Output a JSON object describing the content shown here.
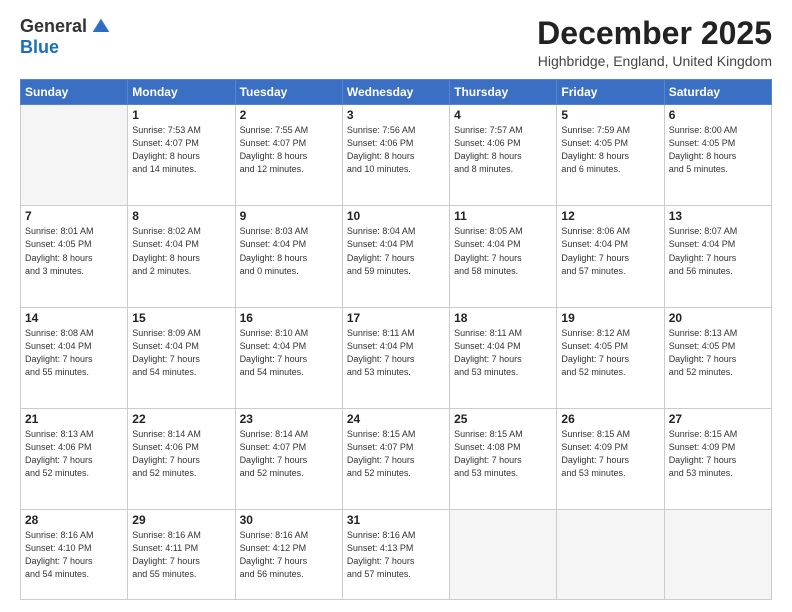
{
  "header": {
    "logo_general": "General",
    "logo_blue": "Blue",
    "title": "December 2025",
    "location": "Highbridge, England, United Kingdom"
  },
  "weekdays": [
    "Sunday",
    "Monday",
    "Tuesday",
    "Wednesday",
    "Thursday",
    "Friday",
    "Saturday"
  ],
  "weeks": [
    [
      {
        "day": "",
        "info": ""
      },
      {
        "day": "1",
        "info": "Sunrise: 7:53 AM\nSunset: 4:07 PM\nDaylight: 8 hours\nand 14 minutes."
      },
      {
        "day": "2",
        "info": "Sunrise: 7:55 AM\nSunset: 4:07 PM\nDaylight: 8 hours\nand 12 minutes."
      },
      {
        "day": "3",
        "info": "Sunrise: 7:56 AM\nSunset: 4:06 PM\nDaylight: 8 hours\nand 10 minutes."
      },
      {
        "day": "4",
        "info": "Sunrise: 7:57 AM\nSunset: 4:06 PM\nDaylight: 8 hours\nand 8 minutes."
      },
      {
        "day": "5",
        "info": "Sunrise: 7:59 AM\nSunset: 4:05 PM\nDaylight: 8 hours\nand 6 minutes."
      },
      {
        "day": "6",
        "info": "Sunrise: 8:00 AM\nSunset: 4:05 PM\nDaylight: 8 hours\nand 5 minutes."
      }
    ],
    [
      {
        "day": "7",
        "info": "Sunrise: 8:01 AM\nSunset: 4:05 PM\nDaylight: 8 hours\nand 3 minutes."
      },
      {
        "day": "8",
        "info": "Sunrise: 8:02 AM\nSunset: 4:04 PM\nDaylight: 8 hours\nand 2 minutes."
      },
      {
        "day": "9",
        "info": "Sunrise: 8:03 AM\nSunset: 4:04 PM\nDaylight: 8 hours\nand 0 minutes."
      },
      {
        "day": "10",
        "info": "Sunrise: 8:04 AM\nSunset: 4:04 PM\nDaylight: 7 hours\nand 59 minutes."
      },
      {
        "day": "11",
        "info": "Sunrise: 8:05 AM\nSunset: 4:04 PM\nDaylight: 7 hours\nand 58 minutes."
      },
      {
        "day": "12",
        "info": "Sunrise: 8:06 AM\nSunset: 4:04 PM\nDaylight: 7 hours\nand 57 minutes."
      },
      {
        "day": "13",
        "info": "Sunrise: 8:07 AM\nSunset: 4:04 PM\nDaylight: 7 hours\nand 56 minutes."
      }
    ],
    [
      {
        "day": "14",
        "info": "Sunrise: 8:08 AM\nSunset: 4:04 PM\nDaylight: 7 hours\nand 55 minutes."
      },
      {
        "day": "15",
        "info": "Sunrise: 8:09 AM\nSunset: 4:04 PM\nDaylight: 7 hours\nand 54 minutes."
      },
      {
        "day": "16",
        "info": "Sunrise: 8:10 AM\nSunset: 4:04 PM\nDaylight: 7 hours\nand 54 minutes."
      },
      {
        "day": "17",
        "info": "Sunrise: 8:11 AM\nSunset: 4:04 PM\nDaylight: 7 hours\nand 53 minutes."
      },
      {
        "day": "18",
        "info": "Sunrise: 8:11 AM\nSunset: 4:04 PM\nDaylight: 7 hours\nand 53 minutes."
      },
      {
        "day": "19",
        "info": "Sunrise: 8:12 AM\nSunset: 4:05 PM\nDaylight: 7 hours\nand 52 minutes."
      },
      {
        "day": "20",
        "info": "Sunrise: 8:13 AM\nSunset: 4:05 PM\nDaylight: 7 hours\nand 52 minutes."
      }
    ],
    [
      {
        "day": "21",
        "info": "Sunrise: 8:13 AM\nSunset: 4:06 PM\nDaylight: 7 hours\nand 52 minutes."
      },
      {
        "day": "22",
        "info": "Sunrise: 8:14 AM\nSunset: 4:06 PM\nDaylight: 7 hours\nand 52 minutes."
      },
      {
        "day": "23",
        "info": "Sunrise: 8:14 AM\nSunset: 4:07 PM\nDaylight: 7 hours\nand 52 minutes."
      },
      {
        "day": "24",
        "info": "Sunrise: 8:15 AM\nSunset: 4:07 PM\nDaylight: 7 hours\nand 52 minutes."
      },
      {
        "day": "25",
        "info": "Sunrise: 8:15 AM\nSunset: 4:08 PM\nDaylight: 7 hours\nand 53 minutes."
      },
      {
        "day": "26",
        "info": "Sunrise: 8:15 AM\nSunset: 4:09 PM\nDaylight: 7 hours\nand 53 minutes."
      },
      {
        "day": "27",
        "info": "Sunrise: 8:15 AM\nSunset: 4:09 PM\nDaylight: 7 hours\nand 53 minutes."
      }
    ],
    [
      {
        "day": "28",
        "info": "Sunrise: 8:16 AM\nSunset: 4:10 PM\nDaylight: 7 hours\nand 54 minutes."
      },
      {
        "day": "29",
        "info": "Sunrise: 8:16 AM\nSunset: 4:11 PM\nDaylight: 7 hours\nand 55 minutes."
      },
      {
        "day": "30",
        "info": "Sunrise: 8:16 AM\nSunset: 4:12 PM\nDaylight: 7 hours\nand 56 minutes."
      },
      {
        "day": "31",
        "info": "Sunrise: 8:16 AM\nSunset: 4:13 PM\nDaylight: 7 hours\nand 57 minutes."
      },
      {
        "day": "",
        "info": ""
      },
      {
        "day": "",
        "info": ""
      },
      {
        "day": "",
        "info": ""
      }
    ]
  ]
}
